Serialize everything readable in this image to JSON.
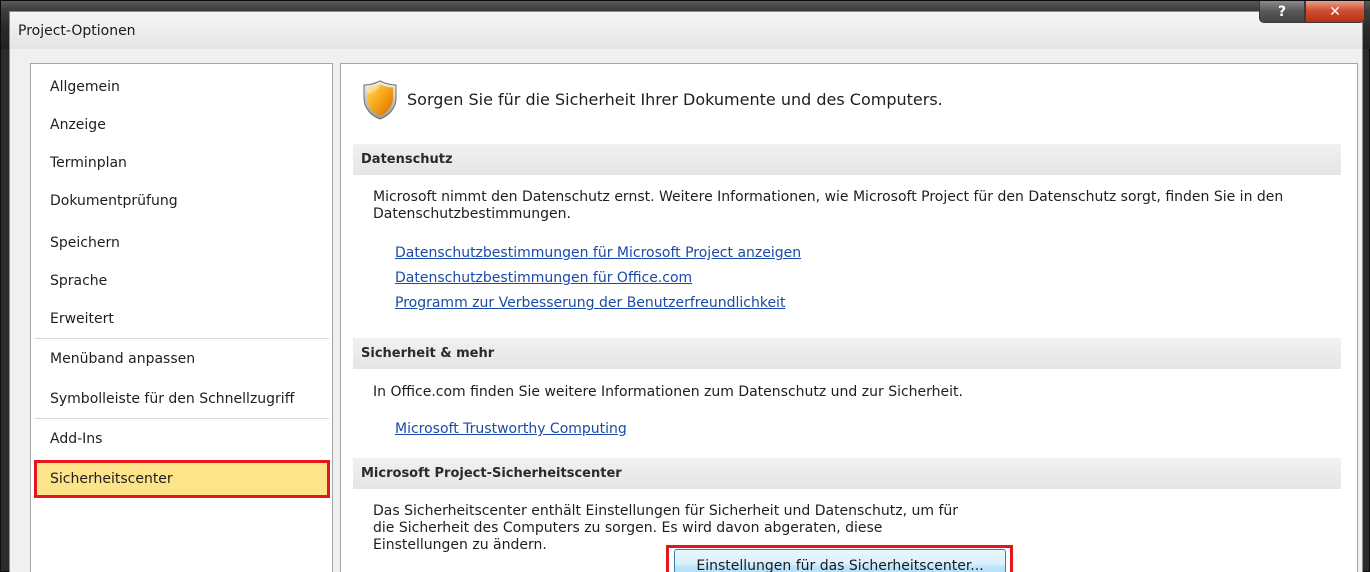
{
  "window": {
    "title": "Project-Optionen"
  },
  "caption": {
    "help_glyph": "?",
    "close_glyph": "✕"
  },
  "sidebar": {
    "items": [
      {
        "label": "Allgemein"
      },
      {
        "label": "Anzeige"
      },
      {
        "label": "Terminplan"
      },
      {
        "label": "Dokumentprüfung"
      },
      {
        "label": "Speichern"
      },
      {
        "label": "Sprache"
      },
      {
        "label": "Erweitert"
      },
      {
        "label": "Menüband anpassen"
      },
      {
        "label": "Symbolleiste für den Schnellzugriff"
      },
      {
        "label": "Add-Ins"
      },
      {
        "label": "Sicherheitscenter"
      }
    ],
    "selected": "Sicherheitscenter",
    "highlight_color": "#fde38a",
    "outline_color": "#e4161b"
  },
  "main": {
    "header": "Sorgen Sie für die Sicherheit Ihrer Dokumente und des Computers.",
    "header_icon": "security-shield-icon",
    "sections": [
      {
        "title": "Datenschutz",
        "text": "Microsoft nimmt den Datenschutz ernst. Weitere Informationen, wie Microsoft Project für den Datenschutz sorgt, finden Sie in den Datenschutzbestimmungen.",
        "links": [
          "Datenschutzbestimmungen für Microsoft Project anzeigen",
          "Datenschutzbestimmungen für Office.com",
          "Programm zur Verbesserung der Benutzerfreundlichkeit"
        ]
      },
      {
        "title": "Sicherheit & mehr",
        "text": "In Office.com finden Sie weitere Informationen zum Datenschutz und zur Sicherheit.",
        "links": [
          "Microsoft Trustworthy Computing"
        ]
      },
      {
        "title": "Microsoft Project-Sicherheitscenter",
        "text": "Das Sicherheitscenter enthält Einstellungen für Sicherheit und Datenschutz, um für die Sicherheit des Computers zu sorgen. Es wird davon abgeraten, diese Einstellungen zu ändern.",
        "button": "Einstellungen für das Sicherheitscenter..."
      }
    ]
  },
  "colors": {
    "link": "#1a4aa8",
    "accent_outline": "#e4161b"
  }
}
